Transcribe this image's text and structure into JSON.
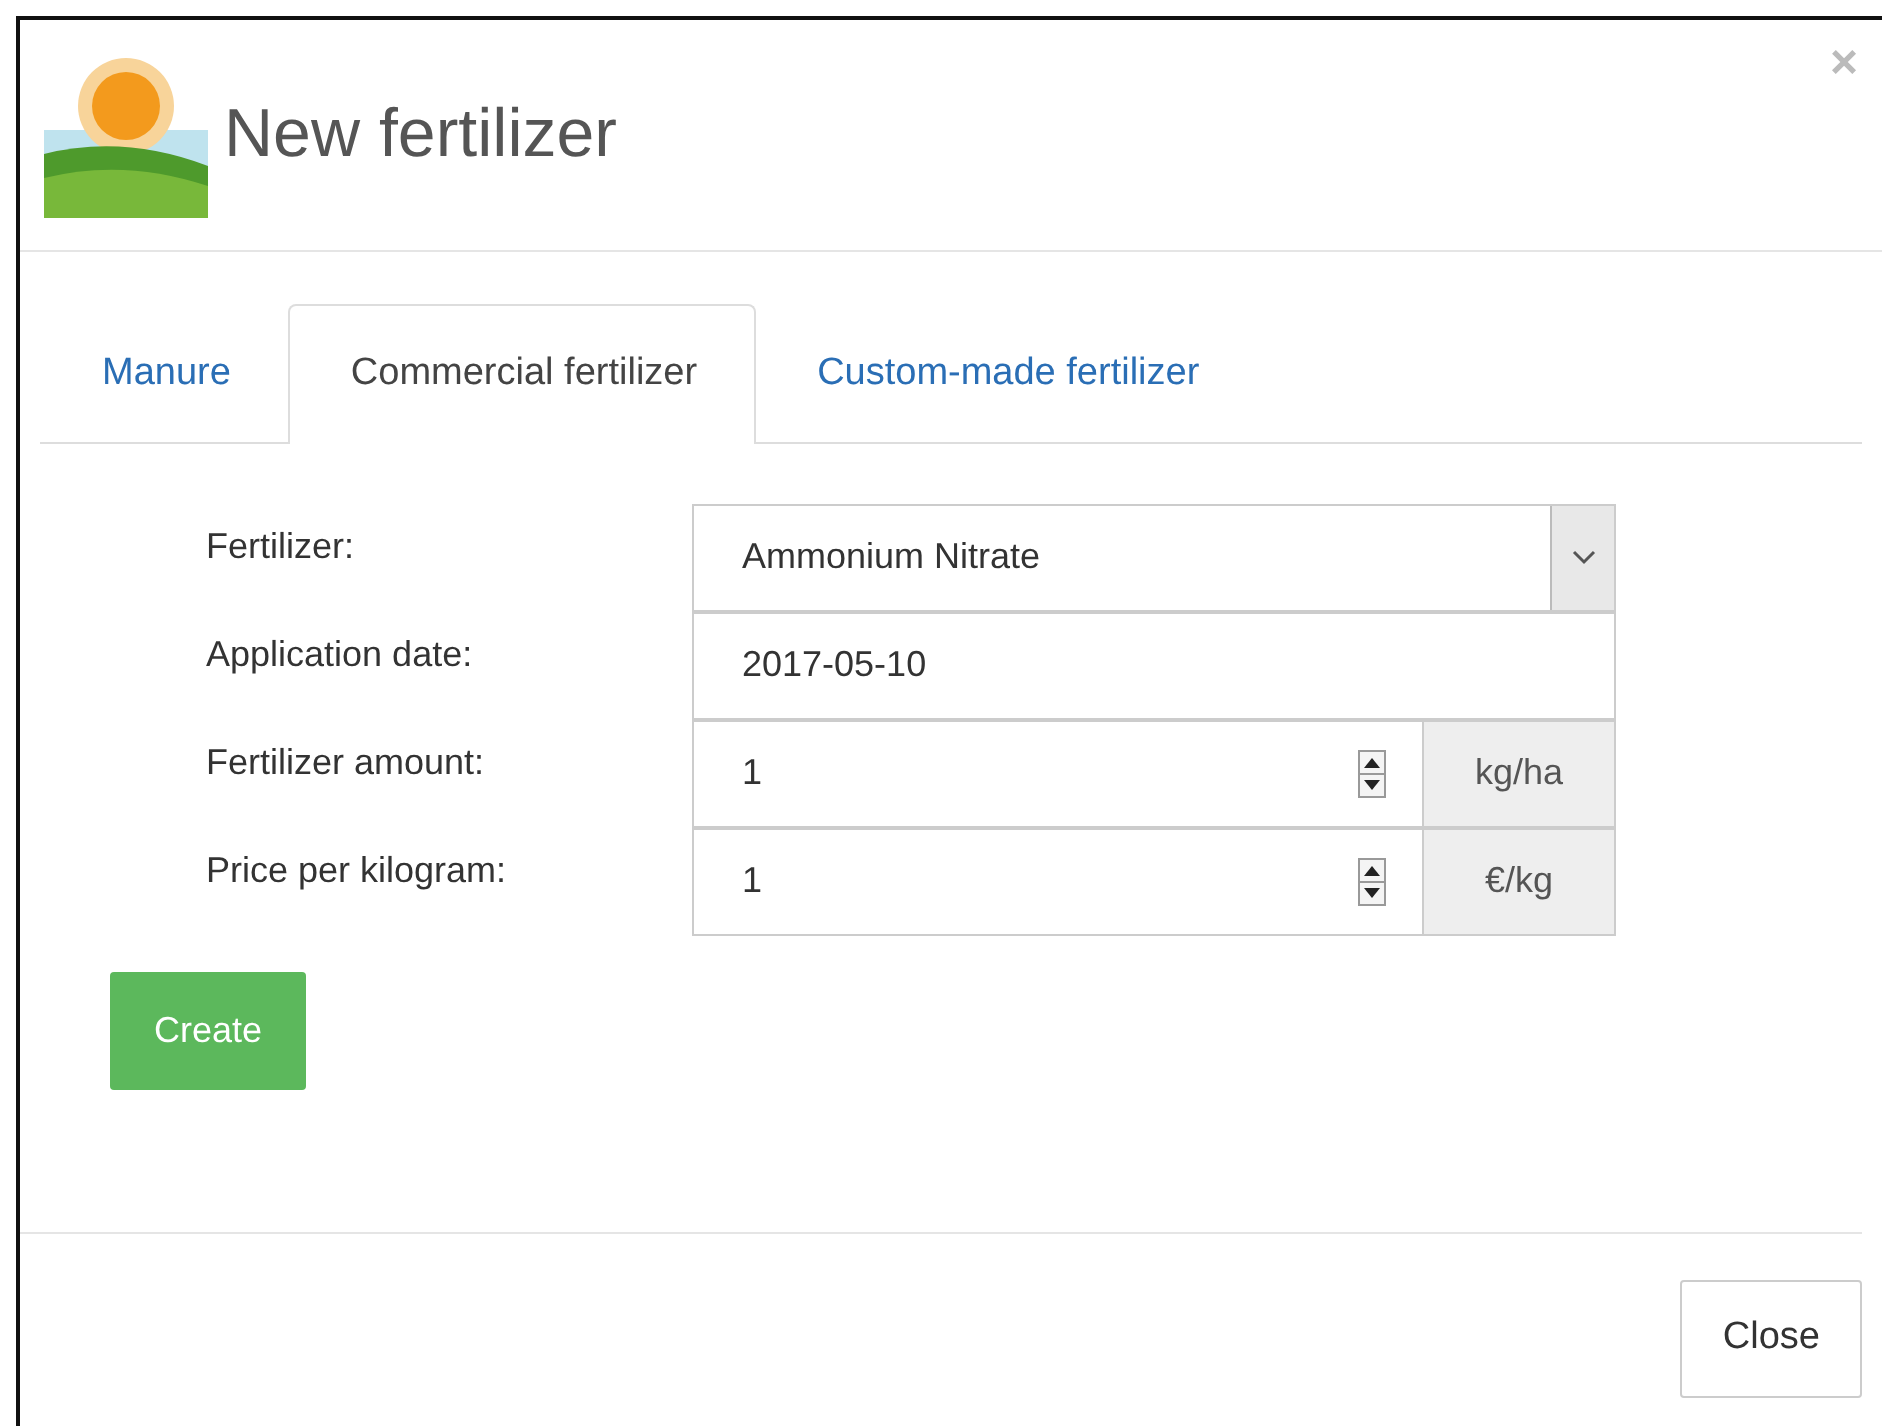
{
  "dialog": {
    "title": "New fertilizer",
    "close_glyph": "×"
  },
  "tabs": [
    {
      "label": "Manure",
      "selected": false
    },
    {
      "label": "Commercial fertilizer",
      "selected": true
    },
    {
      "label": "Custom-made fertilizer",
      "selected": false
    }
  ],
  "fields": [
    {
      "label": "Fertilizer:",
      "kind": "select",
      "value": "Ammonium Nitrate"
    },
    {
      "label": "Application date:",
      "kind": "text",
      "value": "2017-05-10"
    },
    {
      "label": "Fertilizer amount:",
      "kind": "number",
      "value": "1",
      "unit": "kg/ha"
    },
    {
      "label": "Price per kilogram:",
      "kind": "number",
      "value": "1",
      "unit": "€/kg"
    }
  ],
  "create_button": "Create",
  "footer_button": "Close"
}
